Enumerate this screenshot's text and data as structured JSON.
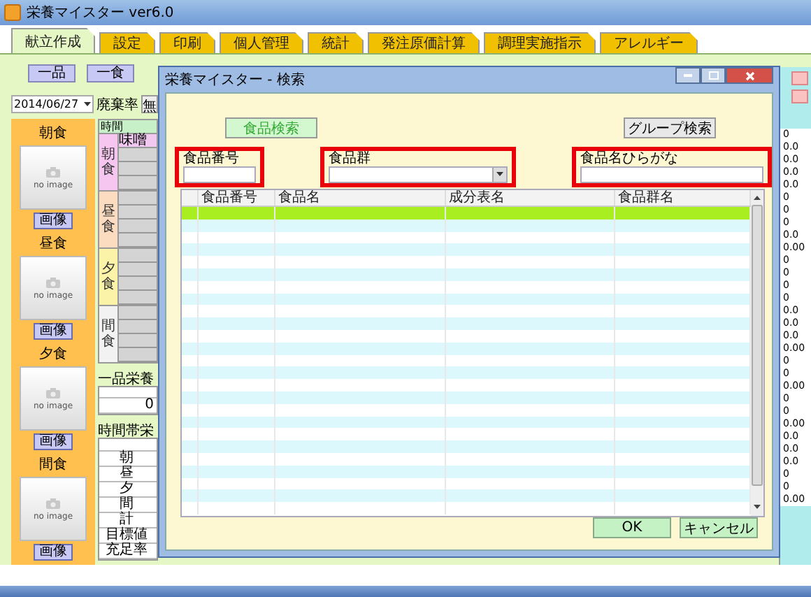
{
  "window": {
    "title": "栄養マイスター ver6.0"
  },
  "tabs": [
    {
      "label": "献立作成",
      "selected": true
    },
    {
      "label": "設定",
      "selected": false
    },
    {
      "label": "印刷",
      "selected": false
    },
    {
      "label": "個人管理",
      "selected": false
    },
    {
      "label": "統計",
      "selected": false
    },
    {
      "label": "発注原価計算",
      "selected": false
    },
    {
      "label": "調理実施指示",
      "selected": false
    },
    {
      "label": "アレルギー",
      "selected": false
    }
  ],
  "toolbar": [
    "一品",
    "一食"
  ],
  "date_field": {
    "value": "2014/06/27"
  },
  "waste_rate": {
    "label": "廃棄率",
    "value": "無"
  },
  "meals": [
    {
      "title": "朝食",
      "image_text": "no image",
      "button": "画像"
    },
    {
      "title": "昼食",
      "image_text": "no image",
      "button": "画像"
    },
    {
      "title": "夕食",
      "image_text": "no image",
      "button": "画像"
    },
    {
      "title": "間食",
      "image_text": "no image",
      "button": "画像"
    }
  ],
  "schedule": {
    "header": "時間",
    "groups": [
      {
        "label": "朝食",
        "color": "#f6c6f0",
        "dishes": [
          "味噌"
        ]
      },
      {
        "label": "昼食",
        "color": "#fbdcc0"
      },
      {
        "label": "夕食",
        "color": "#fbf3a8"
      },
      {
        "label": "間食",
        "color": "#f2f2f2"
      }
    ]
  },
  "single_nutrition": {
    "title": "一品栄養",
    "value": "0"
  },
  "time_nutrition": {
    "title": "時間帯栄",
    "rows": [
      "朝",
      "昼",
      "夕",
      "間",
      "計",
      "目標値",
      "充足率"
    ]
  },
  "side_values": [
    "0",
    "0.0",
    "0.0",
    "0.0",
    "0.0",
    "0",
    "0",
    "0",
    "0.0",
    "0.00",
    "0",
    "0",
    "0",
    "0",
    "0.0",
    "0.0",
    "0.0",
    "0.00",
    "0",
    "0",
    "0.00",
    "0",
    "0",
    "0.00",
    "0.0",
    "0.0",
    "0.0",
    "0",
    "0",
    "0.00"
  ],
  "dialog": {
    "title": "栄養マイスター - 検索",
    "mode_buttons": [
      {
        "label": "食品検索",
        "selected": true
      },
      {
        "label": "グループ検索",
        "selected": false
      }
    ],
    "fields": [
      {
        "kind": "text",
        "label": "食品番号"
      },
      {
        "kind": "select",
        "label": "食品群"
      },
      {
        "kind": "text",
        "label": "食品名ひらがな"
      }
    ],
    "grid": {
      "columns": [
        "食品番号",
        "食品名",
        "成分表名",
        "食品群名"
      ],
      "rows": [
        {
          "selected": true
        },
        {
          "selected": false
        },
        {
          "selected": false
        },
        {
          "selected": false
        },
        {
          "selected": false
        },
        {
          "selected": false
        },
        {
          "selected": false
        },
        {
          "selected": false
        },
        {
          "selected": false
        },
        {
          "selected": false
        },
        {
          "selected": false
        },
        {
          "selected": false
        },
        {
          "selected": false
        },
        {
          "selected": false
        },
        {
          "selected": false
        },
        {
          "selected": false
        },
        {
          "selected": false
        },
        {
          "selected": false
        },
        {
          "selected": false
        },
        {
          "selected": false
        },
        {
          "selected": false
        },
        {
          "selected": false
        },
        {
          "selected": false
        },
        {
          "selected": false
        },
        {
          "selected": false
        }
      ]
    },
    "actions": [
      "OK",
      "キャンセル"
    ]
  }
}
